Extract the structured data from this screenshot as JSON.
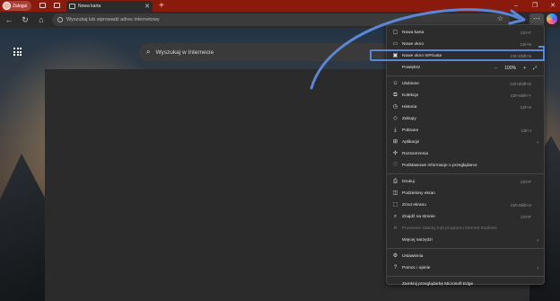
{
  "titlebar": {
    "profile_label": "Zalogui",
    "tab_title": "Nowa karta"
  },
  "toolbar": {
    "address_placeholder": "Wyszukaj lub wprowadź adres internetowy"
  },
  "page": {
    "search_placeholder": "Wyszukaj w Internecie"
  },
  "menu": {
    "items": [
      {
        "label": "Nowa karta",
        "shortcut": "Ctrl+T",
        "icon": "new-tab-icon"
      },
      {
        "label": "Nowe okno",
        "shortcut": "Ctrl+N",
        "icon": "new-window-icon"
      },
      {
        "label": "Nowe okno InPrivate",
        "shortcut": "Ctrl+Shift+N",
        "icon": "inprivate-icon"
      },
      {
        "label": "Powiększ",
        "zoom_value": "100%",
        "icon": "zoom-icon"
      },
      {
        "label": "Ulubione",
        "shortcut": "Ctrl+Shift+O",
        "icon": "favorites-icon"
      },
      {
        "label": "Kolekcje",
        "shortcut": "Ctrl+Shift+Y",
        "icon": "collections-icon"
      },
      {
        "label": "Historia",
        "shortcut": "Ctrl+H",
        "icon": "history-icon"
      },
      {
        "label": "Zakupy",
        "icon": "shopping-icon"
      },
      {
        "label": "Pobrane",
        "shortcut": "Ctrl+J",
        "icon": "downloads-icon"
      },
      {
        "label": "Aplikacje",
        "icon": "apps-icon"
      },
      {
        "label": "Rozszerzenia",
        "icon": "extensions-icon"
      },
      {
        "label": "Podstawowe informacje o przeglądarce",
        "icon": "browser-essentials-icon"
      },
      {
        "label": "Drukuj",
        "shortcut": "Ctrl+P",
        "icon": "print-icon"
      },
      {
        "label": "Podzielony ekran",
        "icon": "split-screen-icon"
      },
      {
        "label": "Zrzut ekranu",
        "shortcut": "Ctrl+Shift+S",
        "icon": "screenshot-icon"
      },
      {
        "label": "Znajdź na stronie",
        "shortcut": "Ctrl+F",
        "icon": "find-icon"
      },
      {
        "label": "Ponownie załaduj tryb programu Internet Explorer",
        "icon": "ie-mode-icon"
      },
      {
        "label": "Więcej narzędzi"
      },
      {
        "label": "Ustawienia",
        "icon": "settings-icon"
      },
      {
        "label": "Pomoc i opinie",
        "icon": "help-icon"
      },
      {
        "label": "Zamknij przeglądarkę Microsoft Edge"
      }
    ]
  },
  "colors": {
    "titlebar": "#8a1a0c",
    "highlight": "#5b86d6",
    "arrow": "#5b86d6"
  }
}
